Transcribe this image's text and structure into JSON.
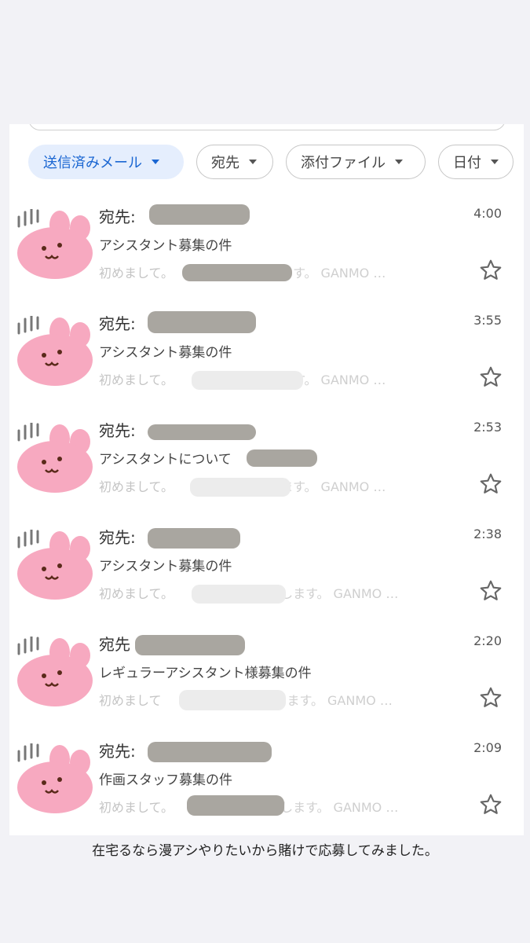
{
  "filters": [
    {
      "label": "送信済みメール",
      "active": true
    },
    {
      "label": "宛先",
      "active": false
    },
    {
      "label": "添付ファイル",
      "active": false
    },
    {
      "label": "日付",
      "active": false
    }
  ],
  "emails": [
    {
      "recipient": "宛先:",
      "time": "4:00",
      "subject": "アシスタント募集の件",
      "snippet": "初めまして。",
      "snippet_tail": "申します。 GANMO …"
    },
    {
      "recipient": "宛先:",
      "time": "3:55",
      "subject": "アシスタント募集の件",
      "snippet": "初めまして。",
      "snippet_tail": "申します。 GANMO …"
    },
    {
      "recipient": "宛先:",
      "time": "2:53",
      "subject": "アシスタントについて",
      "snippet": "初めまして。",
      "snippet_tail": "申します。 GANMO …"
    },
    {
      "recipient": "宛先:",
      "time": "2:38",
      "subject": "アシスタント募集の件",
      "snippet": "初めまして。",
      "snippet_tail": "と申します。 GANMO …"
    },
    {
      "recipient": "宛先",
      "time": "2:20",
      "subject": "レギュラーアシスタント様募集の件",
      "snippet": "初めまして",
      "snippet_tail": "と申します。 GANMO …"
    },
    {
      "recipient": "宛先:",
      "time": "2:09",
      "subject": "作画スタッフ募集の件",
      "snippet": "初めまして。",
      "snippet_tail": "と申します。 GANMO …"
    }
  ],
  "caption": "在宅るなら漫アシやりたいから賭けで応募してみました。",
  "icons": {
    "star": "star-outline-icon",
    "caret": "caret-down-icon",
    "avatar": "pink-rabbit-avatar-icon"
  },
  "colors": {
    "active_chip_bg": "#e5eefd",
    "active_chip_text": "#1a66d2",
    "avatar_pink": "#f7a9c0",
    "redaction": "#a9a6a0"
  }
}
